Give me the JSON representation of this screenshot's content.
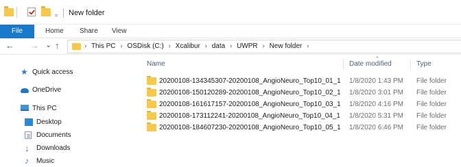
{
  "window": {
    "title": "New folder",
    "qa_dropdown": "="
  },
  "ribbon": {
    "tabs": [
      "File",
      "Home",
      "Share",
      "View"
    ]
  },
  "address": {
    "back": "←",
    "forward": "→",
    "recent": "⌄",
    "up": "↑",
    "root_chevron": "›",
    "crumbs": [
      "This PC",
      "OSDisk (C:)",
      "Xcalibur",
      "data",
      "UWPR",
      "New folder"
    ],
    "separator": "›"
  },
  "nav_pane": {
    "items": [
      {
        "label": "Quick access",
        "icon": "star-icon"
      },
      {
        "label": "OneDrive",
        "icon": "cloud-icon"
      },
      {
        "label": "This PC",
        "icon": "computer-icon"
      },
      {
        "label": "Desktop",
        "icon": "desktop-icon"
      },
      {
        "label": "Documents",
        "icon": "documents-icon"
      },
      {
        "label": "Downloads",
        "icon": "download-icon"
      },
      {
        "label": "Music",
        "icon": "music-icon"
      }
    ]
  },
  "file_list": {
    "columns": {
      "name": "Name",
      "date": "Date modified",
      "type": "Type",
      "sort_indicator": "^"
    },
    "rows": [
      {
        "name": "20200108-134345307-20200108_AngioNeuro_Top10_01_1",
        "date": "1/8/2020 1:43 PM",
        "type": "File folder"
      },
      {
        "name": "20200108-150120289-20200108_AngioNeuro_Top10_02_1",
        "date": "1/8/2020 3:01 PM",
        "type": "File folder"
      },
      {
        "name": "20200108-161617157-20200108_AngioNeuro_Top10_03_1",
        "date": "1/8/2020 4:16 PM",
        "type": "File folder"
      },
      {
        "name": "20200108-173112241-20200108_AngioNeuro_Top10_04_1",
        "date": "1/8/2020 5:31 PM",
        "type": "File folder"
      },
      {
        "name": "20200108-184607230-20200108_AngioNeuro_Top10_05_1",
        "date": "1/8/2020 6:46 PM",
        "type": "File folder"
      }
    ]
  },
  "colors": {
    "accent": "#1979ca",
    "folder": "#f7c948",
    "header_text": "#4c607a"
  }
}
